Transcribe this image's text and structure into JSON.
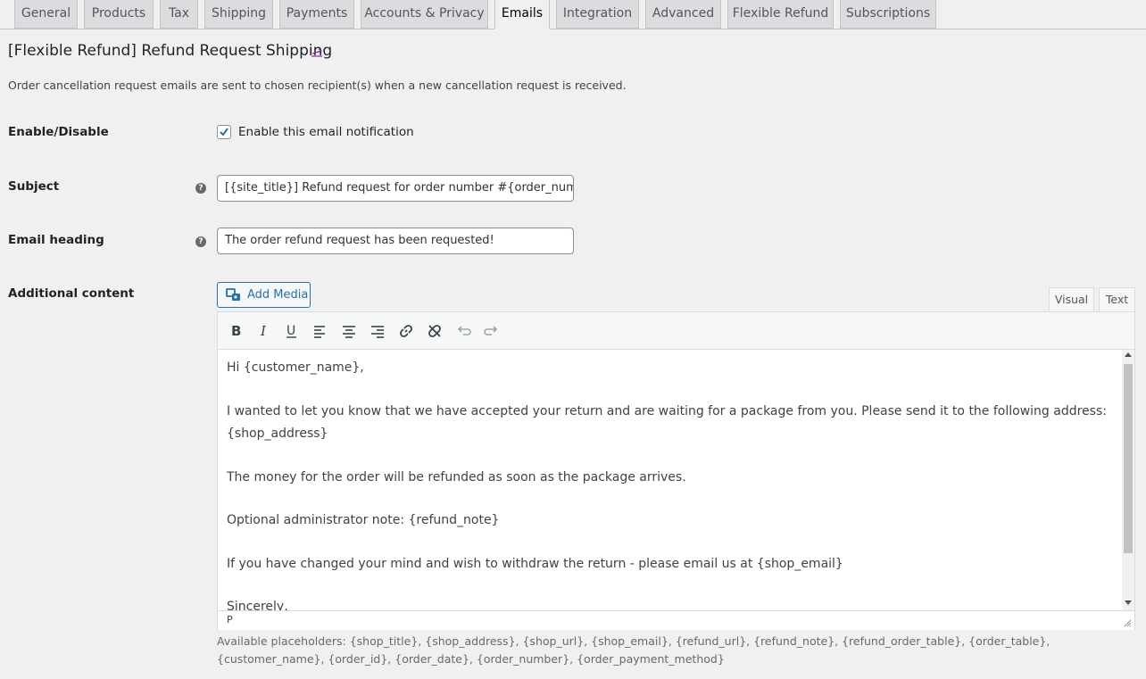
{
  "tabs": [
    {
      "label": "General"
    },
    {
      "label": "Products"
    },
    {
      "label": "Tax"
    },
    {
      "label": "Shipping"
    },
    {
      "label": "Payments"
    },
    {
      "label": "Accounts & Privacy"
    },
    {
      "label": "Emails"
    },
    {
      "label": "Integration"
    },
    {
      "label": "Advanced"
    },
    {
      "label": "Flexible Refund"
    },
    {
      "label": "Subscriptions"
    }
  ],
  "active_tab": "Emails",
  "page": {
    "title": "[Flexible Refund] Refund Request Shipping",
    "description": "Order cancellation request emails are sent to chosen recipient(s) when a new cancellation request is received."
  },
  "fields": {
    "enable": {
      "label": "Enable/Disable",
      "checkbox_label": "Enable this email notification",
      "checked": true
    },
    "subject": {
      "label": "Subject",
      "value": "[{site_title}] Refund request for order number #{order_numer} i"
    },
    "heading": {
      "label": "Email heading",
      "value": "The order refund request has been requested!"
    },
    "additional": {
      "label": "Additional content"
    }
  },
  "editor": {
    "add_media_label": "Add Media",
    "tab_visual": "Visual",
    "tab_text": "Text",
    "toolbar": [
      "bold-icon",
      "italic-icon",
      "underline-icon",
      "align-left-icon",
      "align-center-icon",
      "align-right-icon",
      "link-icon",
      "unlink-icon",
      "undo-icon",
      "redo-icon"
    ],
    "lines": [
      "Hi {customer_name},",
      "I wanted to let you know that we have accepted your return and are waiting for a package from you. Please send it to the following address:",
      "{shop_address}",
      "The money for the order will be refunded as soon as the package arrives.",
      "Optional administrator note: {refund_note}",
      "If you have changed your mind and wish to withdraw the return - please email us at {shop_email}",
      "Sincerely,"
    ],
    "path": "P"
  },
  "placeholders_text": "Available placeholders: {shop_title}, {shop_address}, {shop_url}, {shop_email}, {refund_url}, {refund_note}, {refund_order_table}, {order_table}, {customer_name}, {order_id}, {order_date}, {order_number}, {order_payment_method}",
  "colors": {
    "accent": "#2271b1",
    "background": "#f0f0f1",
    "tab_inactive": "#dcdcde"
  }
}
